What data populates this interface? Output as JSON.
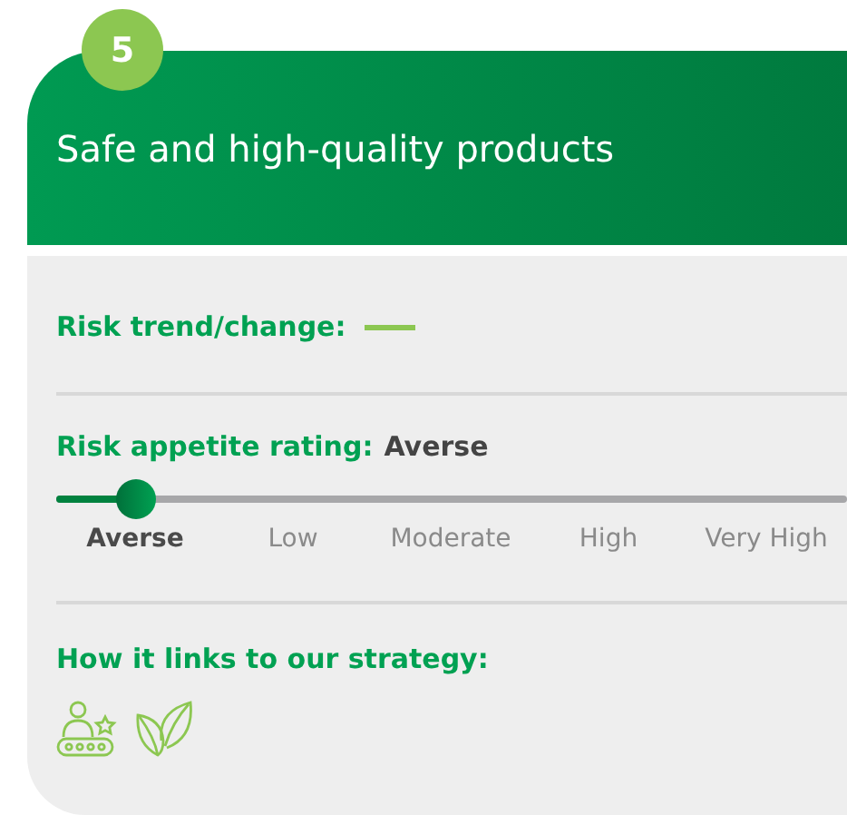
{
  "badge": "5",
  "title": "Safe and high-quality products",
  "trend": {
    "label": "Risk trend/change:",
    "kind": "flat"
  },
  "appetite": {
    "label": "Risk appetite rating:",
    "value": "Averse",
    "level": 0.1,
    "scale": [
      {
        "label": "Averse",
        "selected": true
      },
      {
        "label": "Low",
        "selected": false
      },
      {
        "label": "Moderate",
        "selected": false
      },
      {
        "label": "High",
        "selected": false
      },
      {
        "label": "Very High",
        "selected": false
      }
    ]
  },
  "strategy": {
    "label": "How it links to our strategy:",
    "icons": [
      {
        "kind": "customer"
      },
      {
        "kind": "leaf"
      }
    ]
  }
}
